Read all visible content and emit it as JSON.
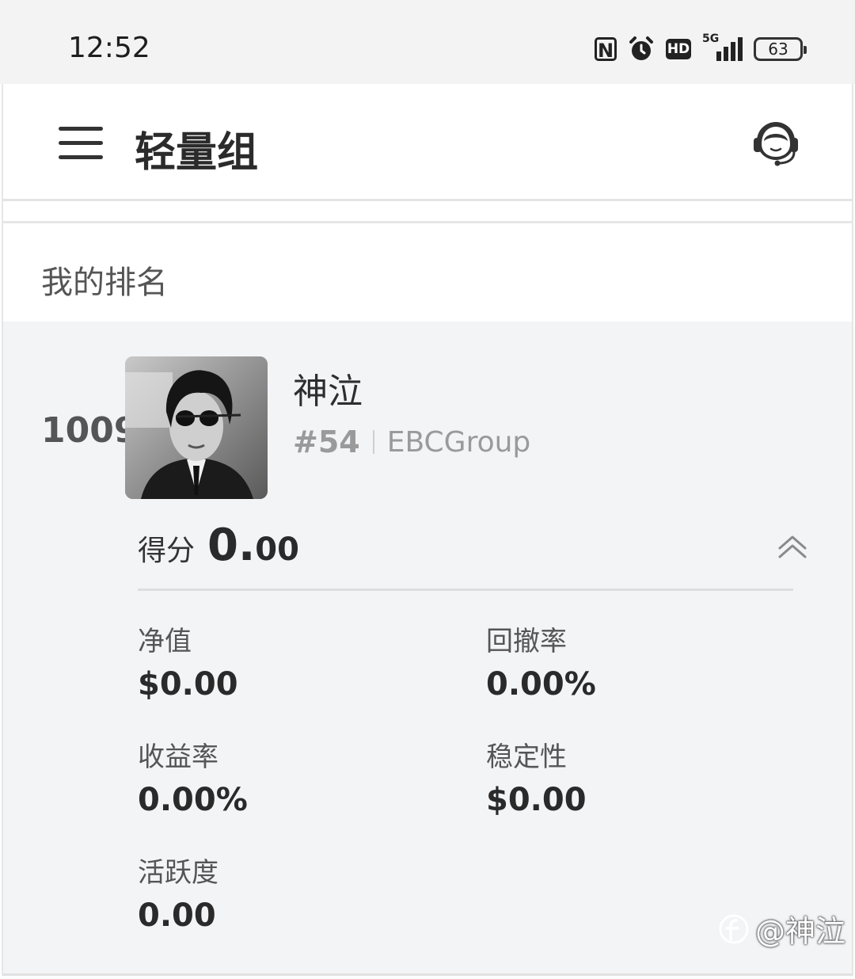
{
  "status_bar": {
    "time": "12:52",
    "network": "5G",
    "hd": "HD",
    "nfc": "N",
    "battery": "63",
    "battery_level": 0.63
  },
  "app_bar": {
    "title": "轻量组",
    "menu_icon": "hamburger-menu-icon",
    "support_icon": "customer-service-headset-icon"
  },
  "ranking": {
    "section_title": "我的排名",
    "rank": "1009",
    "nickname": "神泣",
    "group_no": "#54",
    "group_name": "EBCGroup",
    "score_label": "得分",
    "score_int": "0.",
    "score_dec": "00",
    "stats": [
      {
        "label": "净值",
        "value": "$0.00"
      },
      {
        "label": "回撤率",
        "value": "0.00%"
      },
      {
        "label": "收益率",
        "value": "0.00%"
      },
      {
        "label": "稳定性",
        "value": "$0.00"
      },
      {
        "label": "活跃度",
        "value": "0.00"
      }
    ]
  },
  "watermark": {
    "text": "@神泣"
  },
  "colors": {
    "card_background": "#f3f4f6",
    "muted_text": "#9a9a9a",
    "primary_text": "#2a2a2a"
  }
}
